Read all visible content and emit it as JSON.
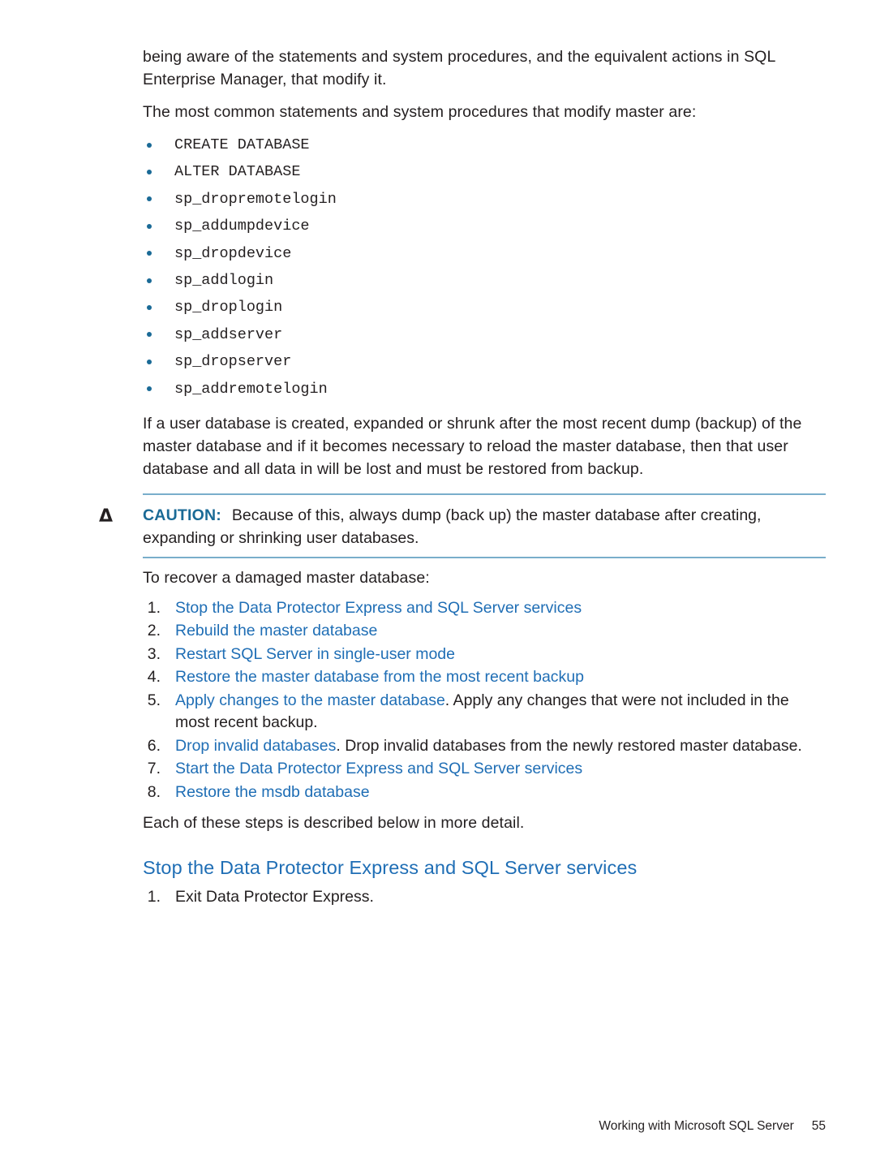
{
  "document": {
    "intro_paragraphs": [
      "being aware of the statements and system procedures, and the equivalent actions in SQL Enterprise Manager, that modify it.",
      "The most common statements and system procedures that modify master are:"
    ],
    "command_list": [
      "CREATE DATABASE",
      "ALTER DATABASE",
      "sp_dropremotelogin",
      "sp_addumpdevice",
      "sp_dropdevice",
      "sp_addlogin",
      "sp_droplogin",
      "sp_addserver",
      "sp_dropserver",
      "sp_addremotelogin"
    ],
    "warning_paragraph": "If a user database is created, expanded or shrunk after the most recent dump (backup) of the master database and if it becomes necessary to reload the master database, then that user database and all data in will be lost and must be restored from backup.",
    "caution": {
      "icon": "caution-triangle-icon",
      "label": "CAUTION:",
      "text": "Because of this, always dump (back up) the master database after creating, expanding or shrinking user databases."
    },
    "recover_lead_in": "To recover a damaged master database:",
    "steps": [
      {
        "number": "1.",
        "link": "Stop the Data Protector Express and SQL Server services",
        "rest": ""
      },
      {
        "number": "2.",
        "link": "Rebuild the master database",
        "rest": ""
      },
      {
        "number": "3.",
        "link": "Restart SQL Server in single-user mode",
        "rest": ""
      },
      {
        "number": "4.",
        "link": "Restore the master database from the most recent backup",
        "rest": ""
      },
      {
        "number": "5.",
        "link": "Apply changes to the master database",
        "rest": ". Apply any changes that were not included in the most recent backup."
      },
      {
        "number": "6.",
        "link": "Drop invalid databases",
        "rest": ". Drop invalid databases from the newly restored master database."
      },
      {
        "number": "7.",
        "link": "Start the Data Protector Express and SQL Server services",
        "rest": ""
      },
      {
        "number": "8.",
        "link": "Restore the msdb database",
        "rest": ""
      }
    ],
    "steps_closing": "Each of these steps is described below in more detail.",
    "section_heading": "Stop the Data Protector Express and SQL Server services",
    "section_steps": [
      {
        "number": "1.",
        "text": "Exit Data Protector Express."
      }
    ]
  },
  "footer": {
    "running_title": "Working with Microsoft SQL Server",
    "page_number": "55"
  },
  "colors": {
    "link_blue": "#1f6eb5",
    "caution_blue": "#1a6a96",
    "rule_blue": "#79aecb",
    "body_text": "#231f20"
  }
}
